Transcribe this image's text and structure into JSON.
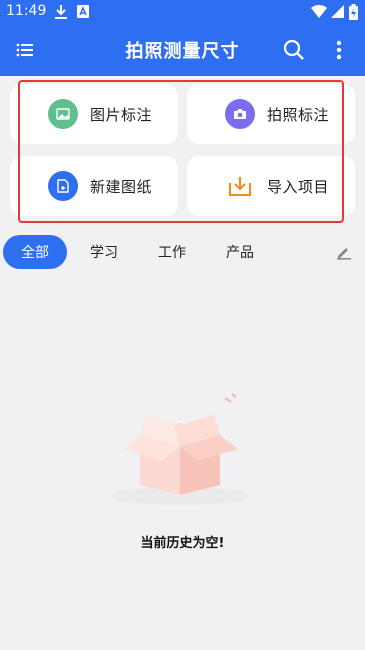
{
  "status_bar": {
    "time": "11:49"
  },
  "app_bar": {
    "title": "拍照测量尺寸"
  },
  "actions": [
    {
      "label": "图片标注",
      "icon": "image-icon",
      "color": "#5fbf8f"
    },
    {
      "label": "拍照标注",
      "icon": "camera-icon",
      "color": "#7c6cf0"
    },
    {
      "label": "新建图纸",
      "icon": "new-file-icon",
      "color": "#2e6ef0"
    },
    {
      "label": "导入项目",
      "icon": "import-icon",
      "color": "#f08a24"
    }
  ],
  "tabs": [
    {
      "label": "全部",
      "active": true
    },
    {
      "label": "学习",
      "active": false
    },
    {
      "label": "工作",
      "active": false
    },
    {
      "label": "产品",
      "active": false
    }
  ],
  "empty_state": {
    "message": "当前历史为空!"
  },
  "colors": {
    "primary": "#2e6ef0",
    "highlight": "#e53935",
    "background": "#f1f1f4"
  }
}
